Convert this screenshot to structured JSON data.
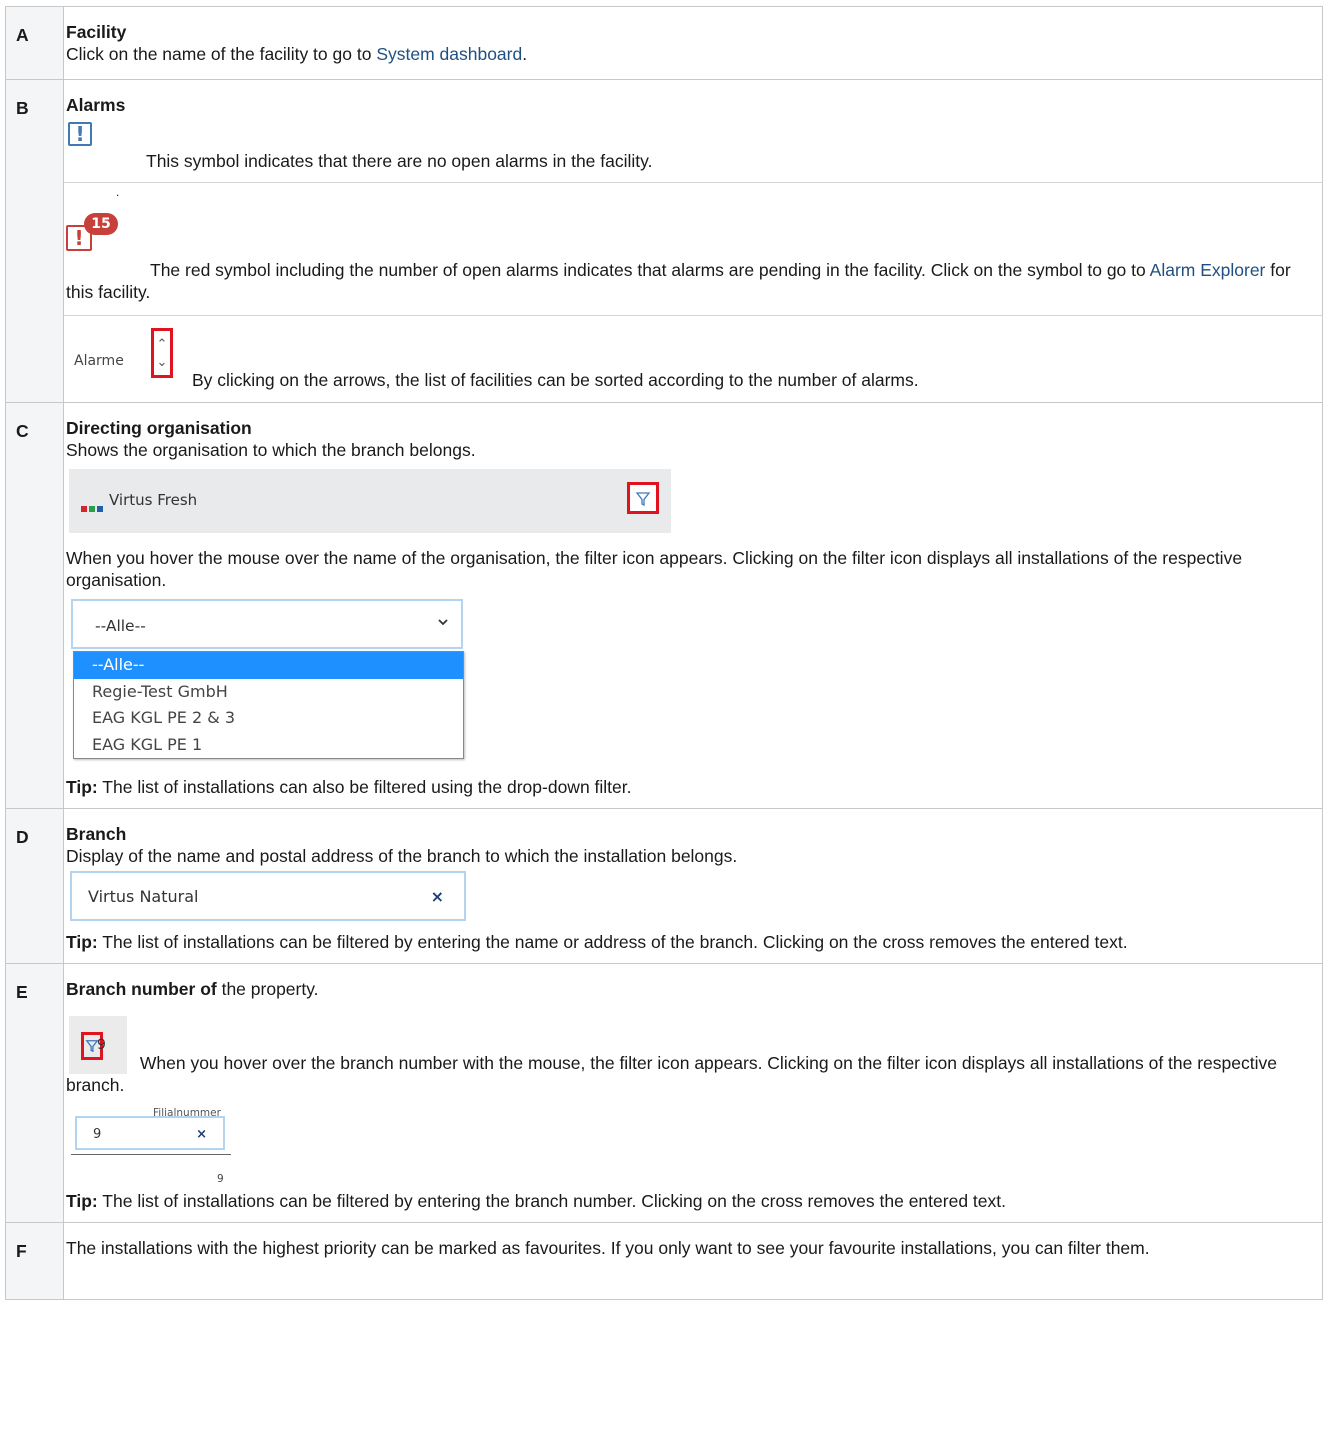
{
  "rows": {
    "A": {
      "letter": "A",
      "title": "Facility",
      "text_before": "Click on the name of the facility to go to ",
      "link": "System dashboard",
      "text_after": "."
    },
    "B": {
      "letter": "B",
      "title": "Alarms",
      "no_alarms_text": "This symbol indicates that there are no open alarms in the facility.",
      "dot": ".",
      "badge_count": "15",
      "red_text_before": "The red symbol including the number of open alarms indicates that alarms are pending in the facility. Click on the symbol to go to ",
      "red_link": "Alarm Explorer",
      "red_text_after": " for this facility.",
      "sort_label": "Alarme",
      "sort_text": "By clicking on the arrows, the list of facilities can be sorted according to the number of alarms."
    },
    "C": {
      "letter": "C",
      "title": "Directing organisation",
      "subtitle": "Shows the organisation to which the branch belongs.",
      "org_name": "Virtus Fresh",
      "hover_text": "When you hover the mouse over the name of the organisation, the filter icon appears. Clicking on the filter icon displays all installations of the respective organisation.",
      "dropdown_value": "--Alle--",
      "dropdown_options": [
        "--Alle--",
        "Regie-Test GmbH",
        "EAG KGL PE 2 & 3",
        "EAG KGL PE 1"
      ],
      "tip_label": "Tip:",
      "tip_text": " The list of installations can also be filtered using the drop-down filter."
    },
    "D": {
      "letter": "D",
      "title": "Branch",
      "subtitle": "Display of the name and postal address of the branch to which the installation belongs.",
      "input_value": "Virtus Natural",
      "clear_symbol": "×",
      "tip_label": "Tip:",
      "tip_text": " The list of installations can be filtered by entering the name or address of the branch. Clicking on the cross removes the entered text."
    },
    "E": {
      "letter": "E",
      "title": "Branch number of",
      "title_after": " the property.",
      "filter_text": "9",
      "hover_text": "When you hover over the branch number with the mouse, the filter icon appears. Clicking on the filter icon displays all installations of the respective branch.",
      "number_label": "Filialnummer",
      "number_value": "9",
      "clear_symbol": "×",
      "below_value": "9",
      "tip_label": "Tip:",
      "tip_text": " The list of installations can be filtered by entering the branch number. Clicking on the cross removes the entered text."
    },
    "F": {
      "letter": "F",
      "text": "The installations with the highest priority can be marked as favourites. If you only want to see your favourite installations, you can filter them."
    }
  },
  "colors": {
    "link": "#205081",
    "alarm_blue": "#3f7ab3",
    "alarm_red": "#c8403c",
    "highlight_box": "#e0141e",
    "dropdown_selected": "#1e90ff"
  }
}
